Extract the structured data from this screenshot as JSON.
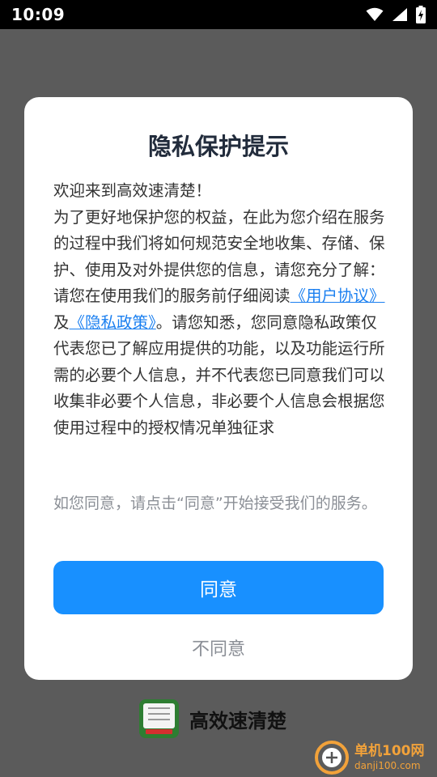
{
  "status_bar": {
    "time": "10:09"
  },
  "dialog": {
    "title": "隐私保护提示",
    "body": {
      "line1": "欢迎来到高效速清楚！",
      "line2": "为了更好地保护您的权益，在此为您介绍在服务的过程中我们将如何规范安全地收集、存储、保护、使用及对外提供您的信息，请您充分了解：",
      "line3_pre": "请您在使用我们的服务前仔细阅读",
      "user_agreement_link": "《用户协议》",
      "line3_mid": "及",
      "privacy_policy_link": "《隐私政策》",
      "line3_post": "。请您知悉，您同意隐私政策仅代表您已了解应用提供的功能，以及功能运行所需的必要个人信息，并不代表您已同意我们可以收集非必要个人信息，非必要个人信息会根据您使用过程中的授权情况单独征求"
    },
    "consent_note": "如您同意，请点击“同意”开始接受我们的服务。",
    "agree_label": "同意",
    "disagree_label": "不同意"
  },
  "brand": {
    "app_name": "高效速清楚"
  },
  "watermark": {
    "main": "单机100网",
    "sub": "danji100.com"
  },
  "colors": {
    "accent": "#1890ff",
    "link": "#1a7ff0",
    "title": "#222c3c",
    "overlay": "#5b5b5b"
  }
}
